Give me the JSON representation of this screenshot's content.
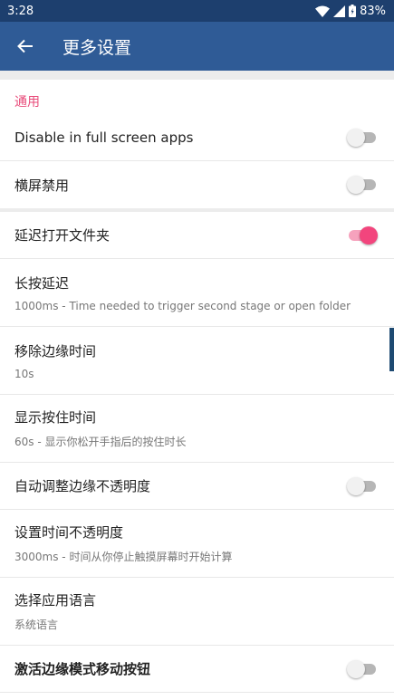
{
  "status_bar": {
    "time": "3:28",
    "battery": "83%"
  },
  "app_bar": {
    "title": "更多设置"
  },
  "section": {
    "general": "通用"
  },
  "settings": {
    "full_screen": {
      "title": "Disable in full screen apps",
      "enabled": false
    },
    "landscape": {
      "title": "横屏禁用",
      "enabled": false
    },
    "delay_folder": {
      "title": "延迟打开文件夹",
      "enabled": true
    },
    "long_press": {
      "title": "长按延迟",
      "subtitle": "1000ms - Time needed to trigger second stage or open folder"
    },
    "remove_edge": {
      "title": "移除边缘时间",
      "subtitle": "10s"
    },
    "show_hold": {
      "title": "显示按住时间",
      "subtitle": "60s - 显示你松开手指后的按住时长"
    },
    "auto_opacity": {
      "title": "自动调整边缘不透明度",
      "enabled": false
    },
    "set_opacity_time": {
      "title": "设置时间不透明度",
      "subtitle": "3000ms - 时间从你停止触摸屏幕时开始计算"
    },
    "app_language": {
      "title": "选择应用语言",
      "subtitle": "系统语言"
    },
    "edge_move_button": {
      "title": "激活边缘模式移动按钮",
      "enabled": false
    }
  },
  "colors": {
    "accent": "#e84b7a",
    "app_bar": "#2f5b96",
    "status_bar": "#1d3f6e"
  }
}
